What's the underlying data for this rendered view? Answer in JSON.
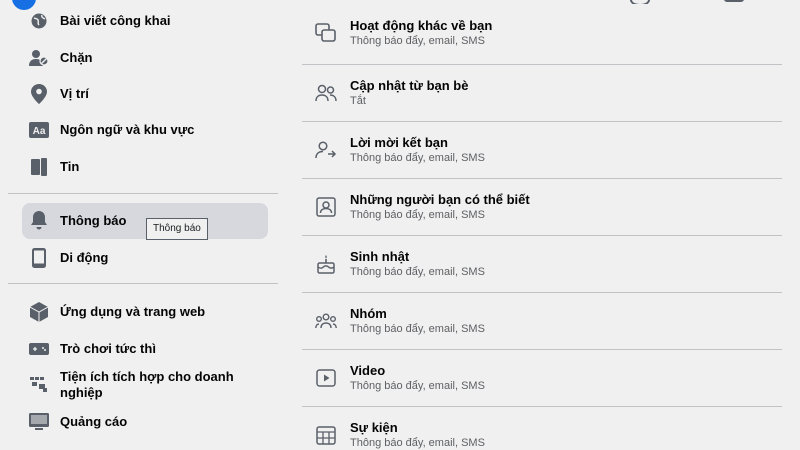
{
  "sidebar": {
    "items": [
      {
        "label": "Bài viết công khai",
        "icon": "globe-icon"
      },
      {
        "label": "Chặn",
        "icon": "block-user-icon"
      },
      {
        "label": "Vị trí",
        "icon": "location-pin-icon"
      },
      {
        "label": "Ngôn ngữ và khu vực",
        "icon": "language-icon"
      },
      {
        "label": "Tin",
        "icon": "book-icon"
      },
      {
        "label": "Thông báo",
        "icon": "bell-icon",
        "active": true
      },
      {
        "label": "Di động",
        "icon": "phone-icon"
      },
      {
        "label": "Ứng dụng và trang web",
        "icon": "cube-icon"
      },
      {
        "label": "Trò chơi tức thì",
        "icon": "gamepad-icon"
      },
      {
        "label": "Tiện ích tích hợp cho doanh nghiệp",
        "icon": "puzzle-icon"
      },
      {
        "label": "Quảng cáo",
        "icon": "monitor-icon"
      }
    ],
    "tooltip": "Thông báo"
  },
  "notifications": {
    "rows": [
      {
        "title": "Hoạt động khác về bạn",
        "subtitle": "Thông báo đẩy, email, SMS",
        "icon": "overlapping-squares-icon"
      },
      {
        "title": "Cập nhật từ bạn bè",
        "subtitle": "Tắt",
        "icon": "friends-icon"
      },
      {
        "title": "Lời mời kết bạn",
        "subtitle": "Thông báo đẩy, email, SMS",
        "icon": "add-friend-icon"
      },
      {
        "title": "Những người bạn có thể biết",
        "subtitle": "Thông báo đẩy, email, SMS",
        "icon": "person-card-icon"
      },
      {
        "title": "Sinh nhật",
        "subtitle": "Thông báo đẩy, email, SMS",
        "icon": "birthday-cake-icon"
      },
      {
        "title": "Nhóm",
        "subtitle": "Thông báo đẩy, email, SMS",
        "icon": "groups-icon"
      },
      {
        "title": "Video",
        "subtitle": "Thông báo đẩy, email, SMS",
        "icon": "video-icon"
      },
      {
        "title": "Sự kiện",
        "subtitle": "Thông báo đẩy, email, SMS",
        "icon": "calendar-icon"
      }
    ]
  },
  "colors": {
    "primary_text": "#050505",
    "secondary_text": "#65676b",
    "icon_gray": "#606770",
    "active_bg": "#e4e6eb",
    "brand": "#1877f2"
  }
}
